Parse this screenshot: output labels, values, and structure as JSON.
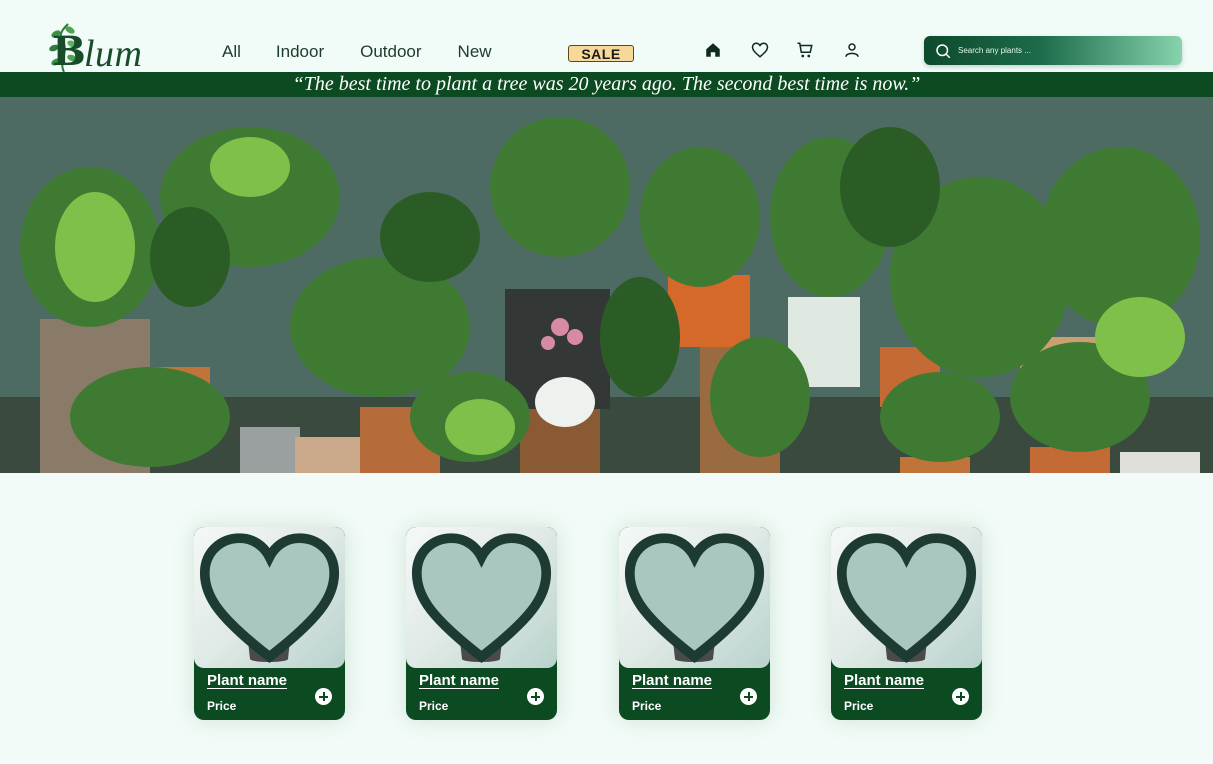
{
  "brand": {
    "logo_letter": "B",
    "logo_rest": "lum"
  },
  "nav": {
    "items": [
      "All",
      "Indoor",
      "Outdoor",
      "New"
    ],
    "sale_label": "SALE"
  },
  "header_icons": [
    "home-icon",
    "heart-icon",
    "cart-icon",
    "user-icon"
  ],
  "search": {
    "placeholder": "Search any plants ..."
  },
  "quote": "“The best time to plant a tree was 20 years ago. The second best time is now.”",
  "products": [
    {
      "name": "Plant name",
      "price": "Price"
    },
    {
      "name": "Plant name",
      "price": "Price"
    },
    {
      "name": "Plant name",
      "price": "Price"
    },
    {
      "name": "Plant name",
      "price": "Price"
    }
  ],
  "colors": {
    "brand_green": "#0c4a22",
    "background": "#f2fbf7",
    "sale_badge": "#f6d99a"
  }
}
